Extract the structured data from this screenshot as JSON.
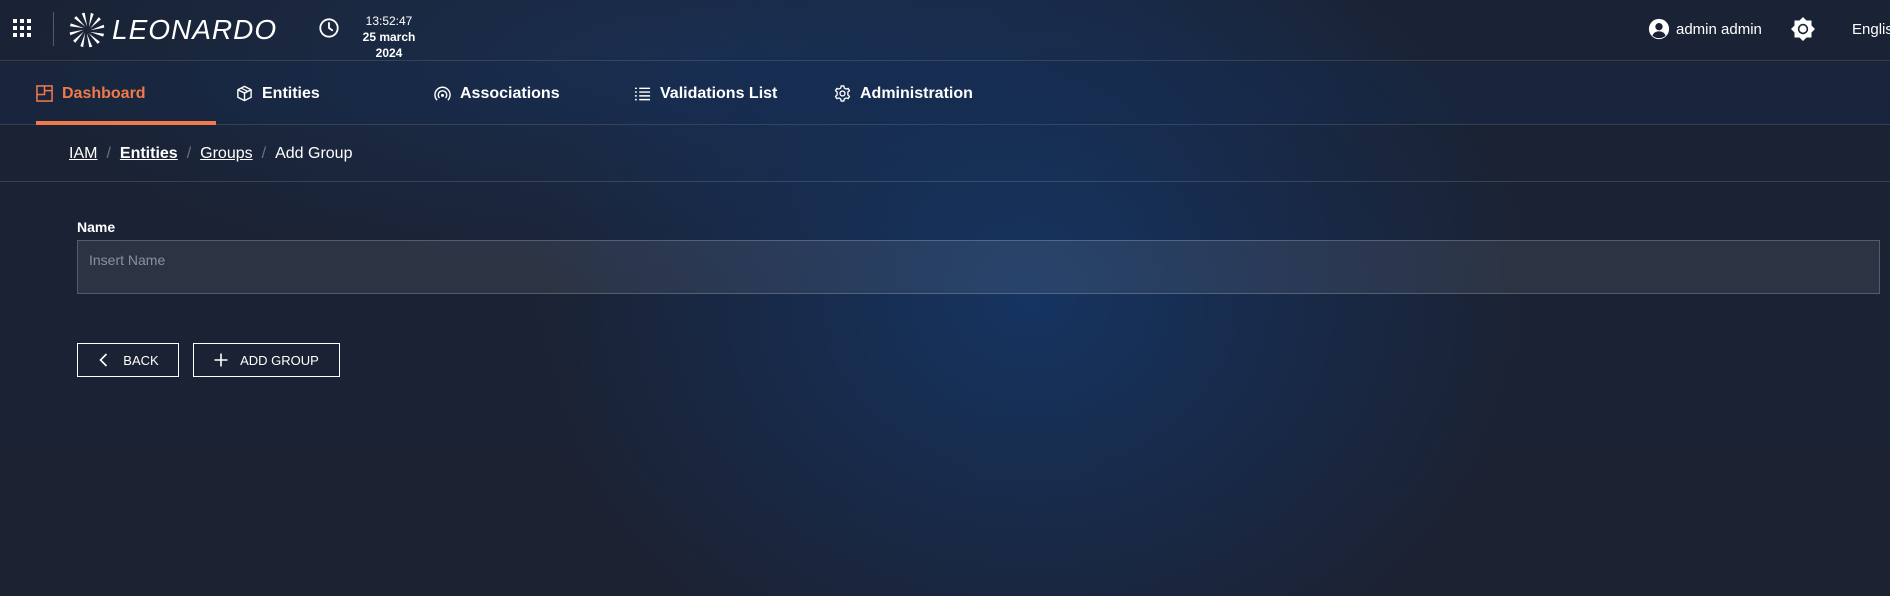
{
  "header": {
    "brand": "LEONARDO",
    "time": "13:52:47",
    "date": "25 march 2024",
    "user_name": "admin admin",
    "language": "English"
  },
  "nav": {
    "tabs": [
      {
        "label": "Dashboard",
        "icon": "dashboard-icon",
        "active": true
      },
      {
        "label": "Entities",
        "icon": "cube-icon",
        "active": false
      },
      {
        "label": "Associations",
        "icon": "signal-icon",
        "active": false
      },
      {
        "label": "Validations List",
        "icon": "list-icon",
        "active": false
      },
      {
        "label": "Administration",
        "icon": "gear-icon",
        "active": false
      }
    ]
  },
  "breadcrumb": {
    "items": [
      "IAM",
      "Entities",
      "Groups",
      "Add Group"
    ]
  },
  "form": {
    "name_label": "Name",
    "name_value": "",
    "name_placeholder": "Insert Name"
  },
  "actions": {
    "back_label": "BACK",
    "add_label": "ADD GROUP"
  },
  "colors": {
    "accent": "#f07a4a",
    "background": "#1b2233"
  }
}
